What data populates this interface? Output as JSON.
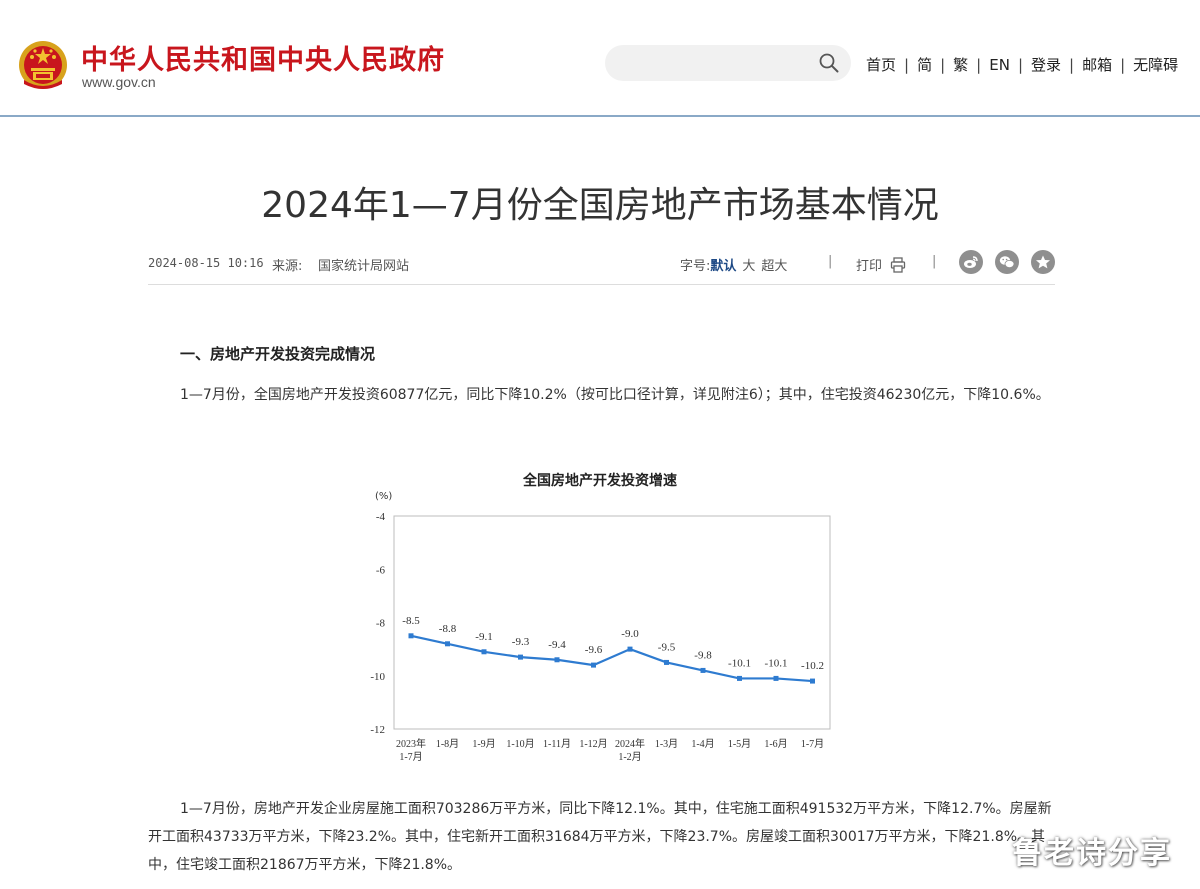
{
  "header": {
    "site_title": "中华人民共和国中央人民政府",
    "site_domain": "www.gov.cn",
    "search": {
      "placeholder": "",
      "value": ""
    },
    "nav": [
      "首页",
      "简",
      "繁",
      "EN",
      "登录",
      "邮箱",
      "无障碍"
    ]
  },
  "article": {
    "title": "2024年1—7月份全国房地产市场基本情况",
    "date": "2024-08-15 10:16",
    "source_label": "来源:",
    "source": "国家统计局网站",
    "fontsize_label": "字号:",
    "fontsize_options": [
      "默认",
      "大",
      "超大"
    ],
    "print_label": "打印",
    "section1_heading": "一、房地产开发投资完成情况",
    "para1": "1—7月份，全国房地产开发投资60877亿元，同比下降10.2%（按可比口径计算，详见附注6）；其中，住宅投资46230亿元，下降10.6%。",
    "para2": "1—7月份，房地产开发企业房屋施工面积703286万平方米，同比下降12.1%。其中，住宅施工面积491532万平方米，下降12.7%。房屋新开工面积43733万平方米，下降23.2%。其中，住宅新开工面积31684万平方米，下降23.7%。房屋竣工面积30017万平方米，下降21.8%。其中，住宅竣工面积21867万平方米，下降21.8%。"
  },
  "share_icons": [
    "weibo-icon",
    "wechat-icon",
    "favorite-icon"
  ],
  "colors": {
    "brand_red": "#c8161d",
    "line_blue": "#2e7bd0",
    "header_border": "#8aa9c7"
  },
  "chart_data": {
    "type": "line",
    "title": "全国房地产开发投资增速",
    "ylabel": "(%)",
    "ylim": [
      -12,
      -4
    ],
    "yticks": [
      -4,
      -6,
      -8,
      -10,
      -12
    ],
    "categories": [
      [
        "2023年",
        "1-7月"
      ],
      [
        "1-8月"
      ],
      [
        "1-9月"
      ],
      [
        "1-10月"
      ],
      [
        "1-11月"
      ],
      [
        "1-12月"
      ],
      [
        "2024年",
        "1-2月"
      ],
      [
        "1-3月"
      ],
      [
        "1-4月"
      ],
      [
        "1-5月"
      ],
      [
        "1-6月"
      ],
      [
        "1-7月"
      ]
    ],
    "series": [
      {
        "values": [
          -8.5,
          -8.8,
          -9.1,
          -9.3,
          -9.4,
          -9.6,
          -9.0,
          -9.5,
          -9.8,
          -10.1,
          -10.1,
          -10.2
        ],
        "labels": [
          "-8.5",
          "-8.8",
          "-9.1",
          "-9.3",
          "-9.4",
          "-9.6",
          "-9.0",
          "-9.5",
          "-9.8",
          "-10.1",
          "-10.1",
          "-10.2"
        ]
      }
    ],
    "grid": false,
    "legend": "none"
  },
  "watermark": "鲁老诗分享"
}
